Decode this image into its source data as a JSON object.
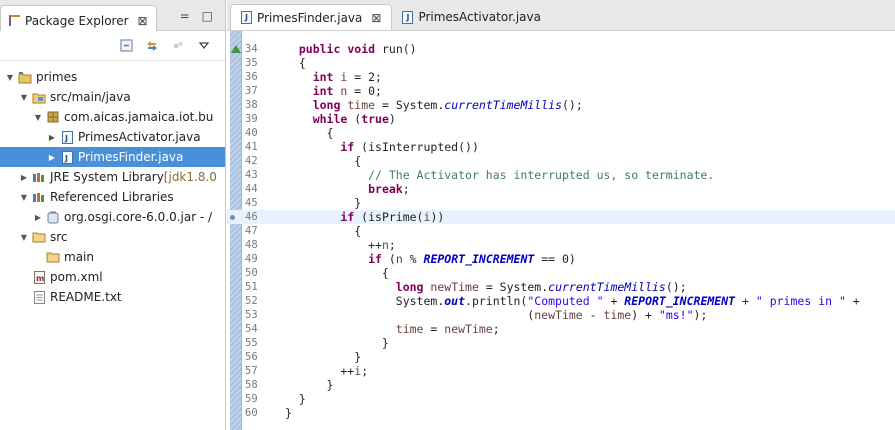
{
  "explorer": {
    "tab_label": "Package Explorer",
    "tab_close": "⊠",
    "minimize": "=",
    "maximize": "□",
    "tree": [
      {
        "label": "primes",
        "twisty": "▼",
        "icon": "project-icon",
        "indent": 0
      },
      {
        "label": "src/main/java",
        "twisty": "▼",
        "icon": "source-folder-icon",
        "indent": 1
      },
      {
        "label": "com.aicas.jamaica.iot.bu",
        "twisty": "▼",
        "icon": "package-icon",
        "indent": 2
      },
      {
        "label": "PrimesActivator.java",
        "twisty": "▶",
        "icon": "java-file-icon",
        "indent": 3
      },
      {
        "label": "PrimesFinder.java",
        "twisty": "▶",
        "icon": "java-file-icon",
        "indent": 3,
        "selected": true
      },
      {
        "label": "JRE System Library",
        "suffix": "[jdk1.8.0",
        "twisty": "▶",
        "icon": "library-icon",
        "indent": 1
      },
      {
        "label": "Referenced Libraries",
        "twisty": "▼",
        "icon": "library-icon",
        "indent": 1
      },
      {
        "label": "org.osgi.core-6.0.0.jar - /",
        "twisty": "▶",
        "icon": "jar-icon",
        "indent": 2
      },
      {
        "label": "src",
        "twisty": "▼",
        "icon": "folder-icon",
        "indent": 1
      },
      {
        "label": "main",
        "twisty": "",
        "icon": "folder-icon",
        "indent": 2
      },
      {
        "label": "pom.xml",
        "twisty": "",
        "icon": "maven-file-icon",
        "indent": 1
      },
      {
        "label": "README.txt",
        "twisty": "",
        "icon": "text-file-icon",
        "indent": 1
      }
    ]
  },
  "editor": {
    "tabs": [
      {
        "label": "PrimesFinder.java",
        "active": true,
        "close": "⊠"
      },
      {
        "label": "PrimesActivator.java",
        "active": false
      }
    ],
    "lines": [
      {
        "num": "34",
        "html": "  <span class=\"kw\">public</span> <span class=\"kw\">void</span> run()"
      },
      {
        "num": "35",
        "html": "  {"
      },
      {
        "num": "36",
        "html": "    <span class=\"kw\">int</span> <span class=\"vr\">i</span> = 2;"
      },
      {
        "num": "37",
        "html": "    <span class=\"kw\">int</span> <span class=\"vr\">n</span> = 0;"
      },
      {
        "num": "38",
        "html": "    <span class=\"kw\">long</span> <span class=\"vr\">time</span> = System.<span class=\"st\">currentTimeMillis</span>();"
      },
      {
        "num": "39",
        "html": "    <span class=\"kw\">while</span> (<span class=\"kw\">true</span>)"
      },
      {
        "num": "40",
        "html": "      {"
      },
      {
        "num": "41",
        "html": "        <span class=\"kw\">if</span> (isInterrupted())"
      },
      {
        "num": "42",
        "html": "          {"
      },
      {
        "num": "43",
        "html": "            <span class=\"cm\">// The Activator has interrupted us, so terminate.</span>"
      },
      {
        "num": "44",
        "html": "            <span class=\"kw\">break</span>;"
      },
      {
        "num": "45",
        "html": "          }"
      },
      {
        "num": "46",
        "html": "        <span class=\"kw\">if</span> (isPrime(<span class=\"vr\">i</span>))",
        "highlight": true,
        "marker": true
      },
      {
        "num": "47",
        "html": "          {"
      },
      {
        "num": "48",
        "html": "            ++<span class=\"vr\">n</span>;"
      },
      {
        "num": "49",
        "html": "            <span class=\"kw\">if</span> (<span class=\"vr\">n</span> % <span class=\"stb\">REPORT_INCREMENT</span> == 0)"
      },
      {
        "num": "50",
        "html": "              {"
      },
      {
        "num": "51",
        "html": "                <span class=\"kw\">long</span> <span class=\"vr\">newTime</span> = System.<span class=\"st\">currentTimeMillis</span>();"
      },
      {
        "num": "52",
        "html": "                System.<span class=\"stb\">out</span>.println(<span class=\"str\">\"Computed \"</span> + <span class=\"stb\">REPORT_INCREMENT</span> + <span class=\"str\">\" primes in \"</span> +"
      },
      {
        "num": "53",
        "html": "                                   (<span class=\"vr\">newTime</span> - <span class=\"vr\">time</span>) + <span class=\"str\">\"ms!\"</span>);"
      },
      {
        "num": "54",
        "html": "                <span class=\"vr\">time</span> = <span class=\"vr\">newTime</span>;"
      },
      {
        "num": "55",
        "html": "              }"
      },
      {
        "num": "56",
        "html": "          }"
      },
      {
        "num": "57",
        "html": "        ++<span class=\"vr\">i</span>;"
      },
      {
        "num": "58",
        "html": "      }"
      },
      {
        "num": "59",
        "html": "  }"
      },
      {
        "num": "60",
        "html": "}"
      }
    ]
  }
}
